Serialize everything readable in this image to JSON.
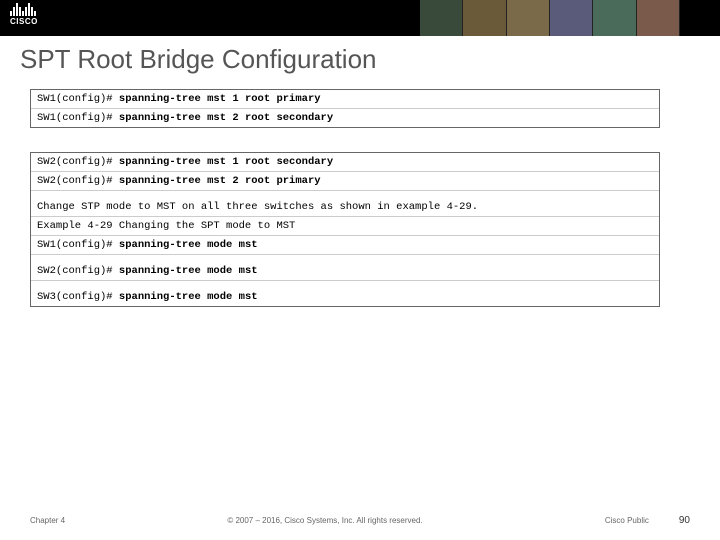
{
  "logo": {
    "text": "CISCO"
  },
  "title": "SPT Root Bridge Configuration",
  "box1": [
    {
      "prompt": "SW1(config)# ",
      "cmd": "spanning-tree mst 1 root primary"
    },
    {
      "prompt": "SW1(config)# ",
      "cmd": "spanning-tree mst 2 root secondary"
    }
  ],
  "box2": {
    "l1_prompt": "SW2(config)# ",
    "l1_cmd": "spanning-tree mst 1 root secondary",
    "l2_prompt": "SW2(config)# ",
    "l2_cmd": "spanning-tree mst 2 root primary",
    "l3": "Change STP mode to MST on all three switches as shown in example 4-29.",
    "l4": "Example 4-29 Changing the SPT mode to MST",
    "l5_prompt": "SW1(config)# ",
    "l5_cmd": "spanning-tree mode mst",
    "l6_prompt": "SW2(config)# ",
    "l6_cmd": "spanning-tree mode mst",
    "l7_prompt": "SW3(config)# ",
    "l7_cmd": "spanning-tree mode mst"
  },
  "footer": {
    "chapter": "Chapter 4",
    "copyright": "© 2007 – 2016, Cisco Systems, Inc. All rights reserved.",
    "public": "Cisco Public",
    "page": "90"
  }
}
